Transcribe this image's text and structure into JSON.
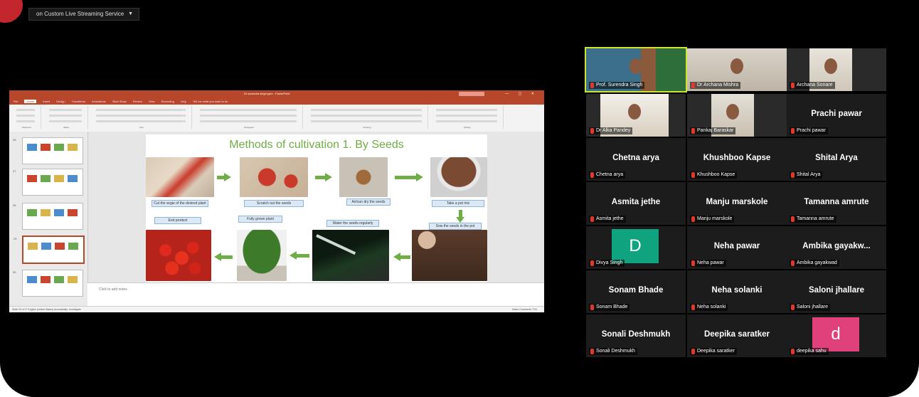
{
  "share_bar": {
    "label": "on Custom Live Streaming Service"
  },
  "ppt": {
    "window_title": "Dr surendra singh.pptx - PowerPoint",
    "tabs": [
      "File",
      "Home",
      "Insert",
      "Design",
      "Transitions",
      "Animations",
      "Slide Show",
      "Review",
      "View",
      "Recording",
      "Help",
      "Tell me what you want to do"
    ],
    "active_tab": "Home",
    "ribbon_groups": [
      "Clipboard",
      "Slides",
      "Font",
      "Paragraph",
      "Drawing",
      "Editing"
    ],
    "thumb_numbers": [
      "26",
      "27",
      "28",
      "29",
      "30"
    ],
    "notes_placeholder": "Click to add notes",
    "status_left": "Slide 29 of 37     English (United States)     Accessibility: Investigate",
    "status_right": "Notes   Comments   71%"
  },
  "slide": {
    "title": "Methods of cultivation 1. By Seeds",
    "captions": {
      "cut": "Cut the vegie of the desired plant",
      "scratch": "Scratch out the seeds",
      "dry": "Air/sun dry the seeds",
      "pot_mix": "Take a pot mix",
      "sow": "Sow the seeds in the pot",
      "water": "Water the seeds regularly",
      "grown": "Fully grown plant",
      "end": "End product"
    }
  },
  "participants": [
    {
      "tile": "Prof. Surendra Singh",
      "label": "Prof. Surendra Singh",
      "kind": "video",
      "speaker": true
    },
    {
      "tile": "Dr Archana Mishra",
      "label": "Dr Archana Mishra",
      "kind": "video"
    },
    {
      "tile": "Archana Sonare",
      "label": "Archana Sonare",
      "kind": "video"
    },
    {
      "tile": "Dr Alka Pandey",
      "label": "Dr Alka Pandey",
      "kind": "video"
    },
    {
      "tile": "Pankaj Baraskar",
      "label": "Pankaj Baraskar",
      "kind": "video"
    },
    {
      "tile": "Prachi pawar",
      "label": "Prachi pawar",
      "kind": "name"
    },
    {
      "tile": "Chetna arya",
      "label": "Chetna arya",
      "kind": "name"
    },
    {
      "tile": "Khushboo Kapse",
      "label": "Khushboo Kapse",
      "kind": "name"
    },
    {
      "tile": "Shital Arya",
      "label": "Shital Arya",
      "kind": "name"
    },
    {
      "tile": "Asmita jethe",
      "label": "Asmita jethe",
      "kind": "name"
    },
    {
      "tile": "Manju marskole",
      "label": "Manju marskole",
      "kind": "name"
    },
    {
      "tile": "Tamanna amrute",
      "label": "Tamanna amrute",
      "kind": "name"
    },
    {
      "tile": "D",
      "label": "Divya Singh",
      "kind": "avatar",
      "color": "#10a37f"
    },
    {
      "tile": "Neha pawar",
      "label": "Neha pawar",
      "kind": "name"
    },
    {
      "tile": "Ambika gayakw...",
      "label": "Ambika gayakwad",
      "kind": "name"
    },
    {
      "tile": "Sonam Bhade",
      "label": "Sonam Bhade",
      "kind": "name"
    },
    {
      "tile": "Neha solanki",
      "label": "Neha solanki",
      "kind": "name"
    },
    {
      "tile": "Saloni jhallare",
      "label": "Saloni jhallare",
      "kind": "name"
    },
    {
      "tile": "Sonali Deshmukh",
      "label": "Sonali Deshmukh",
      "kind": "name"
    },
    {
      "tile": "Deepika saratker",
      "label": "Deepika saratker",
      "kind": "name"
    },
    {
      "tile": "d",
      "label": "deepika sahu",
      "kind": "avatar",
      "color": "#e0417a"
    }
  ],
  "colors": {
    "ppt_accent": "#b7472a",
    "slide_green": "#70ad47",
    "speaker_outline": "#cfe42e",
    "mic_muted": "#e0392b"
  }
}
